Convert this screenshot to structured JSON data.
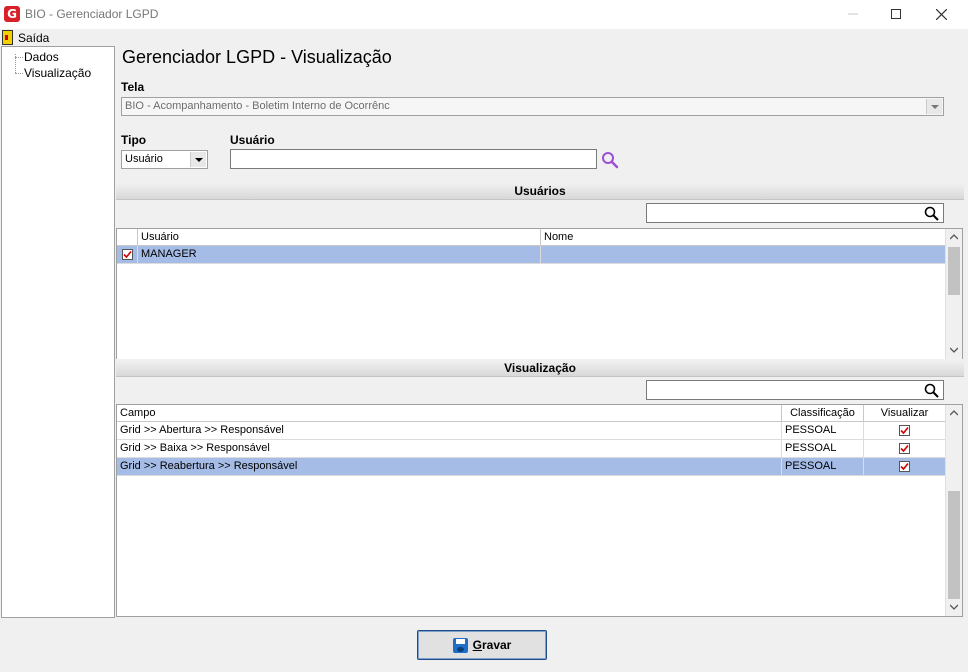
{
  "window": {
    "app_icon": "G",
    "title": "BIO - Gerenciador LGPD"
  },
  "menu": {
    "exit_label": "Saída",
    "exit_icon": "exit-door-icon"
  },
  "tree": {
    "items": [
      {
        "label": "Dados"
      },
      {
        "label": "Visualização"
      }
    ]
  },
  "page": {
    "title": "Gerenciador LGPD - Visualização"
  },
  "form": {
    "tela_label": "Tela",
    "tela_value": "BIO - Acompanhamento - Boletim Interno de Ocorrênc",
    "tipo_label": "Tipo",
    "tipo_value": "Usuário",
    "usuario_label": "Usuário",
    "usuario_value": ""
  },
  "usuarios_section": {
    "title": "Usuários",
    "filter_value": "",
    "columns": [
      "Usuário",
      "Nome"
    ],
    "rows": [
      {
        "checked": true,
        "usuario": "MANAGER",
        "nome": "",
        "selected": true
      }
    ]
  },
  "visualizacao_section": {
    "title": "Visualização",
    "filter_value": "",
    "columns": [
      "Campo",
      "Classificação",
      "Visualizar"
    ],
    "rows": [
      {
        "campo": "Grid >> Abertura >> Responsável",
        "classificacao": "PESSOAL",
        "visualizar": true,
        "selected": false
      },
      {
        "campo": "Grid >> Baixa >> Responsável",
        "classificacao": "PESSOAL",
        "visualizar": true,
        "selected": false
      },
      {
        "campo": "Grid >> Reabertura >> Responsável",
        "classificacao": "PESSOAL",
        "visualizar": true,
        "selected": true
      }
    ]
  },
  "actions": {
    "save_prefix": "G",
    "save_rest": "ravar"
  },
  "colors": {
    "selection": "#a5bce6",
    "check_red": "#d00000",
    "search_purple": "#9b4fd6"
  }
}
